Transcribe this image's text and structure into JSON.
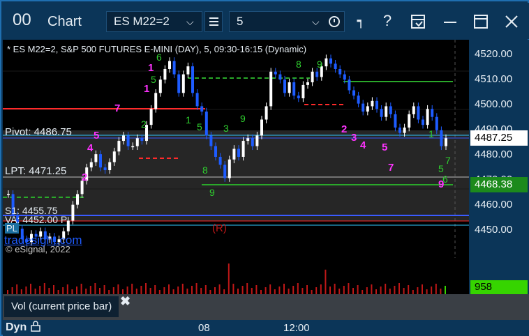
{
  "window": {
    "title_glyph": "00",
    "title": "Chart",
    "symbol_value": "ES M22=2",
    "interval_value": "5"
  },
  "toolbar": {
    "icons": [
      "chevron-down-icon",
      "menu-icon",
      "chevron-down-icon",
      "clock-icon",
      "pin-icon",
      "help-icon",
      "template-icon",
      "maximize-icon",
      "close-icon"
    ],
    "help_label": "?"
  },
  "chart": {
    "header": "* ES M22=2, S&P 500 FUTURES E-MINI (DAY), 5, 09:30-16:15 (Dynamic)",
    "overlays": {
      "pivot": "Pivot: 4486.75",
      "lpt": "LPT: 4471.25",
      "s1": "S1: 4455.75",
      "va": "VA: 4452.00 P",
      "pl": "PL",
      "tradesight": "tradesight.com",
      "esignal": "© eSignal, 2022",
      "r_marker": "(R)"
    },
    "y_axis_labels": [
      "4520.00",
      "4510.00",
      "4500.00",
      "4490.00",
      "4480.00",
      "4470.00",
      "4460.00",
      "4450.00"
    ],
    "current_price": "4487.25",
    "level_price": "4468.38",
    "x_axis_labels": [
      "08",
      "12:00"
    ],
    "bottom_left": "Dyn",
    "colors": {
      "background": "#000000",
      "panel": "#0b3558",
      "up_candle": "#ffffff",
      "down_candle": "#1e5cff",
      "pivot_line": "#2fc7ff",
      "red_line": "#ff2a2a",
      "green_line": "#2aa82a",
      "magenta_count": "#ff33ff",
      "green_count": "#2fcf2f"
    }
  },
  "volume": {
    "value": "958",
    "legend_label": "Vol (current price bar)",
    "close_symbol": "✖"
  },
  "chart_data": {
    "type": "candlestick",
    "y_range": [
      4442,
      4524
    ],
    "closes": [
      4466,
      4458,
      4453,
      4449,
      4448,
      4451,
      4450,
      4452,
      4449,
      4450,
      4448,
      4449,
      4452,
      4456,
      4462,
      4466,
      4471,
      4476,
      4478,
      4481,
      4476,
      4475,
      4478,
      4482,
      4486,
      4488,
      4484,
      4484,
      4487,
      4486,
      4492,
      4498,
      4504,
      4509,
      4513,
      4516,
      4511,
      4504,
      4511,
      4514,
      4504,
      4499,
      4497,
      4488,
      4484,
      4480,
      4477,
      4472,
      4479,
      4483,
      4480,
      4486,
      4487,
      4484,
      4488,
      4494,
      4499,
      4512,
      4511,
      4509,
      4504,
      4508,
      4503,
      4502,
      4507,
      4508,
      4512,
      4510,
      4514,
      4517,
      4515,
      4513,
      4511,
      4509,
      4505,
      4503,
      4500,
      4497,
      4499,
      4501,
      4498,
      4495,
      4499,
      4496,
      4491,
      4489,
      4491,
      4496,
      4499,
      4494,
      4492,
      4498,
      4495,
      4490,
      4484,
      4487
    ],
    "volume_spikes": {
      "index_48": 1.0,
      "index_69": 0.8,
      "index_96": 1.0
    }
  }
}
